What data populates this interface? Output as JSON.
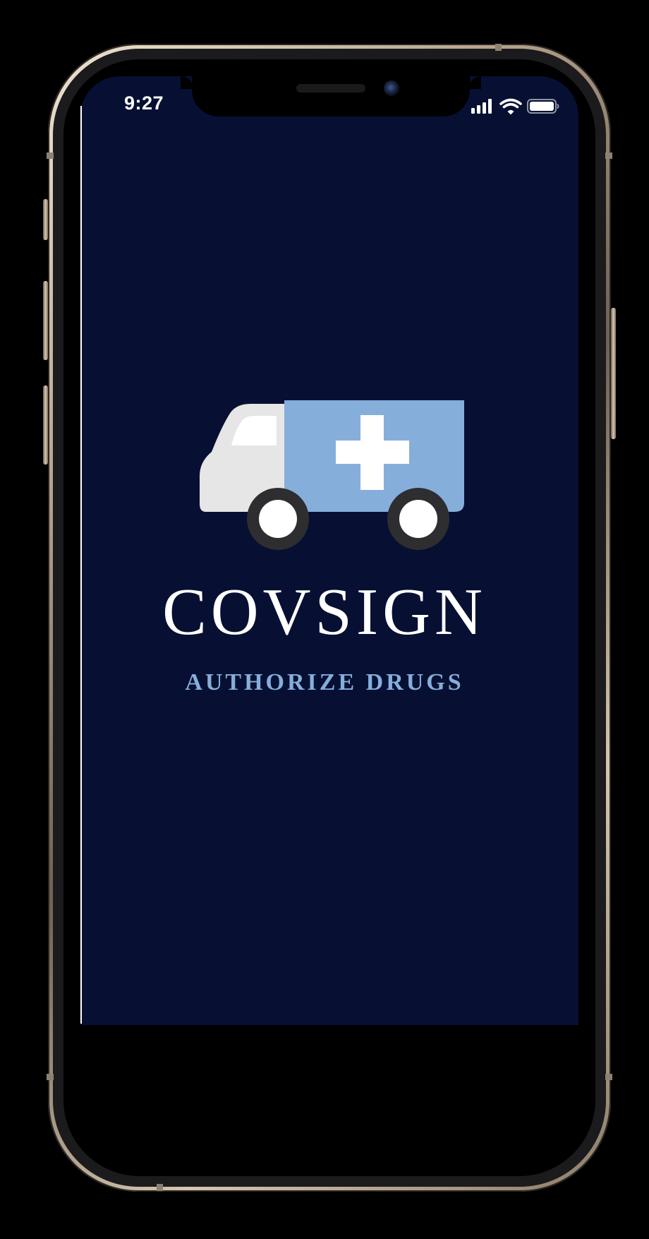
{
  "status_bar": {
    "time": "9:27",
    "signal_icon": "cellular-signal-icon",
    "wifi_icon": "wifi-icon",
    "battery_icon": "battery-full-icon"
  },
  "splash": {
    "logo_icon": "ambulance-icon",
    "brand_name": "COVSIGN",
    "tagline": "AUTHORIZE DRUGS"
  },
  "colors": {
    "screen_background": "#071033",
    "accent_blue": "#86aedb",
    "brand_text": "#ffffff",
    "vehicle_cab": "#e6e6e6",
    "wheel_tire": "#2e2e30"
  }
}
